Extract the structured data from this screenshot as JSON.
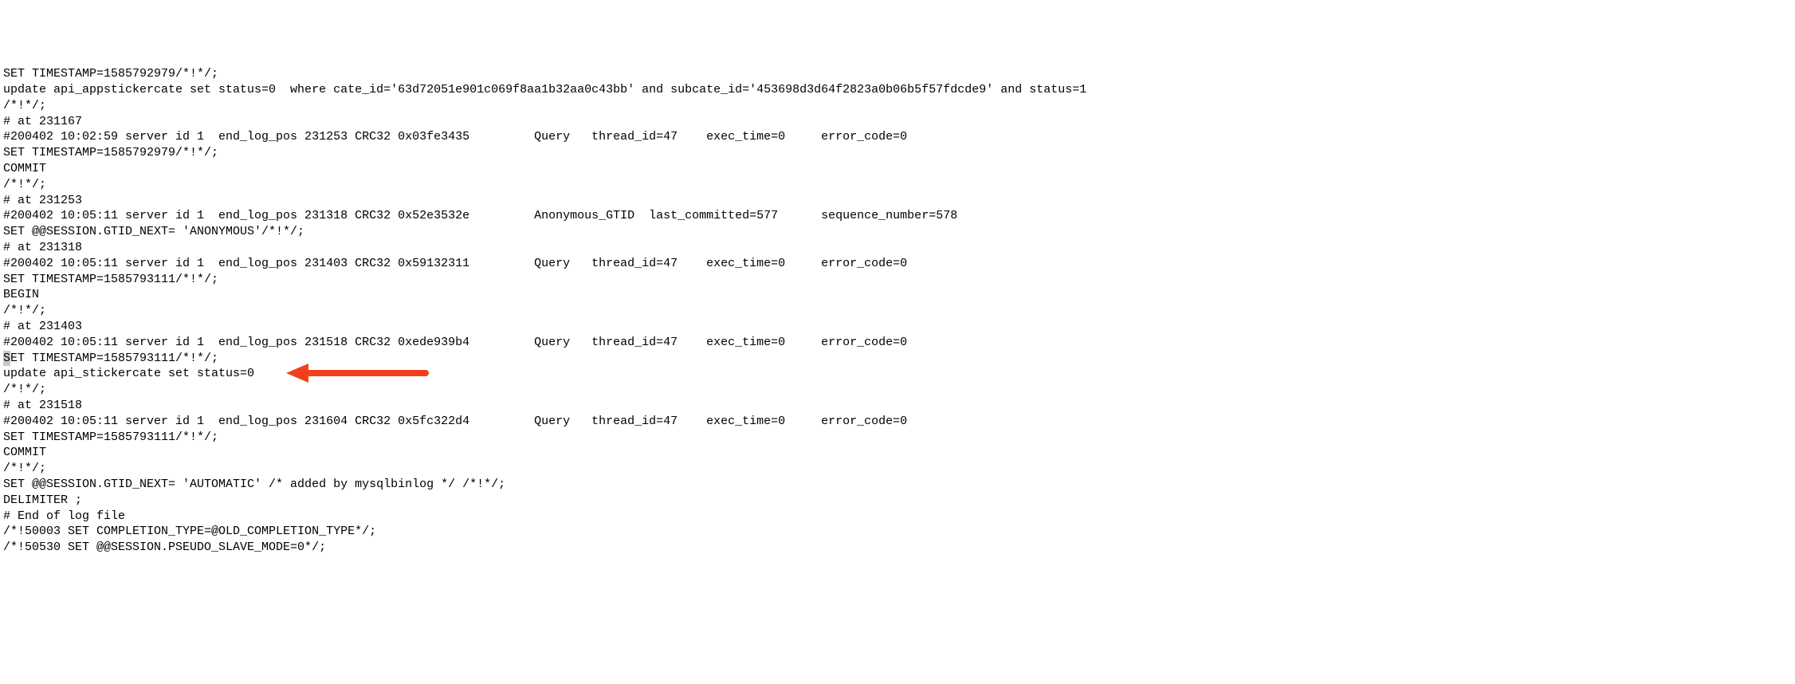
{
  "lines": [
    "SET TIMESTAMP=1585792979/*!*/;",
    "update api_appstickercate set status=0  where cate_id='63d72051e901c069f8aa1b32aa0c43bb' and subcate_id='453698d3d64f2823a0b06b5f57fdcde9' and status=1",
    "/*!*/;",
    "# at 231167",
    "#200402 10:02:59 server id 1  end_log_pos 231253 CRC32 0x03fe3435         Query   thread_id=47    exec_time=0     error_code=0",
    "SET TIMESTAMP=1585792979/*!*/;",
    "COMMIT",
    "/*!*/;",
    "# at 231253",
    "#200402 10:05:11 server id 1  end_log_pos 231318 CRC32 0x52e3532e         Anonymous_GTID  last_committed=577      sequence_number=578",
    "SET @@SESSION.GTID_NEXT= 'ANONYMOUS'/*!*/;",
    "# at 231318",
    "#200402 10:05:11 server id 1  end_log_pos 231403 CRC32 0x59132311         Query   thread_id=47    exec_time=0     error_code=0",
    "SET TIMESTAMP=1585793111/*!*/;",
    "BEGIN",
    "/*!*/;",
    "# at 231403",
    "#200402 10:05:11 server id 1  end_log_pos 231518 CRC32 0xede939b4         Query   thread_id=47    exec_time=0     error_code=0"
  ],
  "highlighted_line_rest": "ET TIMESTAMP=1585793111/*!*/;",
  "highlighted_char": "S",
  "arrow_line": "update api_stickercate set status=0",
  "lines_after": [
    "/*!*/;",
    "# at 231518",
    "#200402 10:05:11 server id 1  end_log_pos 231604 CRC32 0x5fc322d4         Query   thread_id=47    exec_time=0     error_code=0",
    "SET TIMESTAMP=1585793111/*!*/;",
    "COMMIT",
    "/*!*/;",
    "SET @@SESSION.GTID_NEXT= 'AUTOMATIC' /* added by mysqlbinlog */ /*!*/;",
    "DELIMITER ;",
    "# End of log file",
    "/*!50003 SET COMPLETION_TYPE=@OLD_COMPLETION_TYPE*/;",
    "/*!50530 SET @@SESSION.PSEUDO_SLAVE_MODE=0*/;"
  ]
}
